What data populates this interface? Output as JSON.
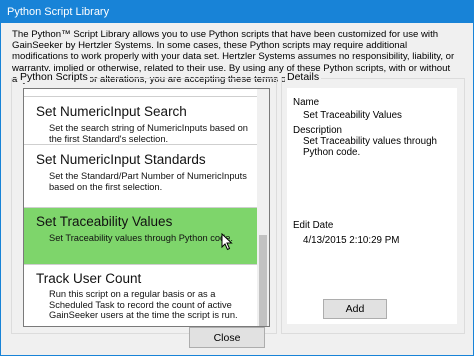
{
  "window": {
    "title": "Python Script Library"
  },
  "intro_text": "The Python™ Script Library allows you to use Python scripts that have been customized for use with GainSeeker by Hertzler Systems. In some cases, these Python scripts may require additional modifications to work properly with your data set. Hertzler Systems assumes no responsibility, liability, or warranty, implied or otherwise, related to their use. By using any of these Python scripts, with or without any modifications or alterations, you are accepting these terms of use.",
  "scripts_panel": {
    "label": "Python Scripts",
    "items": [
      {
        "name": "",
        "description": ""
      },
      {
        "name": "Set NumericInput Search",
        "description": "Set the search string of NumericInputs based on the first Standard's selection."
      },
      {
        "name": "Set NumericInput Standards",
        "description": "Set the Standard/Part Number of NumericInputs based on the first selection."
      },
      {
        "name": "Set Traceability Values",
        "description": "Set Traceability values through Python code."
      },
      {
        "name": "Track User Count",
        "description": "Run this script on a regular basis or as a Scheduled Task to record the count of active GainSeeker users at the time the script is run."
      }
    ],
    "selected_index": 3
  },
  "details_panel": {
    "label": "Details",
    "name_label": "Name",
    "name_value": "Set Traceability Values",
    "description_label": "Description",
    "description_value": "Set Traceability values through Python code.",
    "edit_date_label": "Edit Date",
    "edit_date_value": "4/13/2015 2:10:29 PM",
    "add_button": "Add"
  },
  "footer": {
    "close_button": "Close"
  },
  "colors": {
    "titlebar": "#1883d7",
    "selected_item": "#7ed56b"
  }
}
